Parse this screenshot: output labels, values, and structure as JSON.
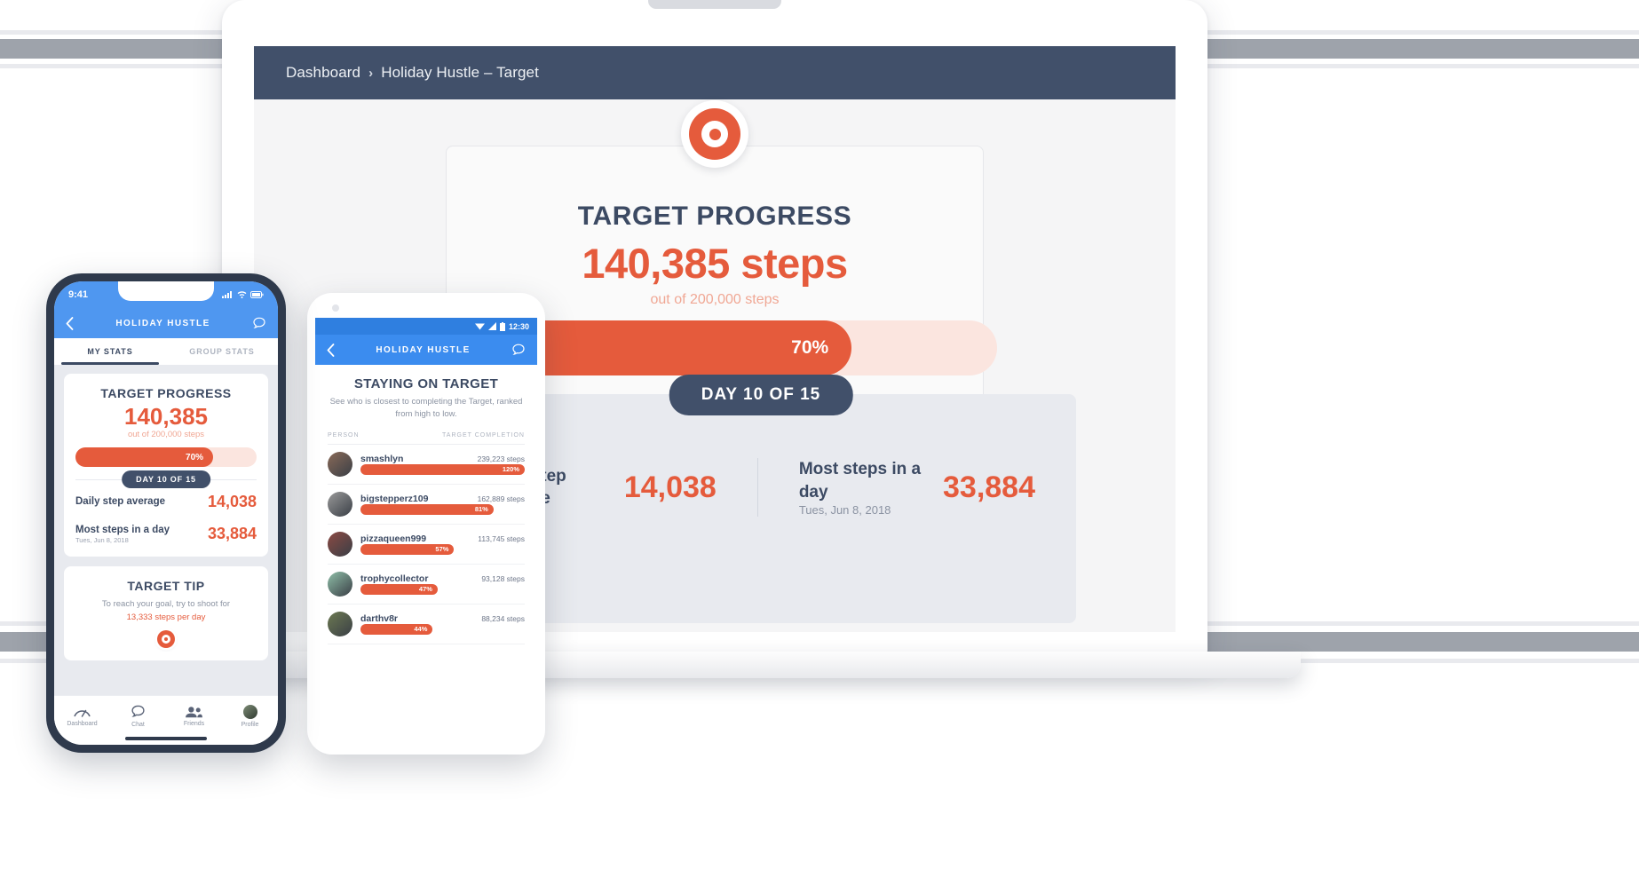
{
  "colors": {
    "accent": "#e55b3c",
    "accent_light": "#fbe5df",
    "accent_soft_text": "#f0a794",
    "dark": "#3c4a63",
    "topbar": "#41506a",
    "ios_blue": "#4f97f0",
    "android_blue": "#3b8cef",
    "page_bg": "#e8eaef"
  },
  "desktop": {
    "breadcrumb": {
      "root": "Dashboard",
      "separator": "›",
      "current": "Holiday Hustle – Target"
    },
    "target_icon": "target-icon",
    "title": "TARGET PROGRESS",
    "steps_value": "140,385 steps",
    "steps_goal": "out of 200,000 steps",
    "progress_label": "70%",
    "progress_percent": 70,
    "day_pill": "DAY 10 OF 15",
    "stats": [
      {
        "label": "Daily step average",
        "date": "",
        "value": "14,038"
      },
      {
        "label": "Most steps in a day",
        "date": "Tues, Jun 8, 2018",
        "value": "33,884"
      }
    ]
  },
  "iphone": {
    "status": {
      "time": "9:41",
      "signal": "signal-icon",
      "wifi": "wifi-icon",
      "battery": "battery-icon"
    },
    "header": {
      "back": "back-chevron-icon",
      "title": "HOLIDAY HUSTLE",
      "chat": "chat-icon"
    },
    "tabs": [
      {
        "label": "MY STATS",
        "active": true
      },
      {
        "label": "GROUP STATS",
        "active": false
      }
    ],
    "progress_card": {
      "title": "TARGET PROGRESS",
      "steps_value": "140,385",
      "steps_goal": "out of 200,000 steps",
      "progress_label": "70%",
      "progress_percent": 70,
      "day_pill": "DAY 10 OF 15",
      "rows": [
        {
          "label": "Daily step average",
          "date": "",
          "value": "14,038"
        },
        {
          "label": "Most steps in a day",
          "date": "Tues, Jun 8, 2018",
          "value": "33,884"
        }
      ]
    },
    "tip_card": {
      "title": "TARGET TIP",
      "text_lead": "To reach your goal, try to shoot for",
      "text_strong": "13,333 steps per day",
      "icon": "target-icon"
    },
    "tabbar": [
      {
        "icon": "activity-icon",
        "label": "Dashboard"
      },
      {
        "icon": "chat-icon",
        "label": "Chat"
      },
      {
        "icon": "friends-icon",
        "label": "Friends"
      },
      {
        "icon": "avatar-icon",
        "label": "Profile"
      }
    ]
  },
  "android": {
    "status": {
      "time": "12:30",
      "wifi": "wifi-icon",
      "signal": "signal-icon",
      "battery": "battery-icon"
    },
    "header": {
      "back": "back-chevron-icon",
      "title": "HOLIDAY HUSTLE",
      "chat": "chat-icon"
    },
    "heading": "STAYING ON TARGET",
    "subheading": "See who is closest to completing the Target, ranked from high to low.",
    "columns": {
      "person": "PERSON",
      "completion": "TARGET COMPLETION"
    },
    "leaderboard": [
      {
        "name": "smashlyn",
        "steps": "239,223 steps",
        "percent_label": "120%",
        "percent": 100,
        "avatar_color": "#8a6a58"
      },
      {
        "name": "bigstepperz109",
        "steps": "162,889 steps",
        "percent_label": "81%",
        "percent": 81,
        "avatar_color": "#9a9a9a"
      },
      {
        "name": "pizzaqueen999",
        "steps": "113,745 steps",
        "percent_label": "57%",
        "percent": 57,
        "avatar_color": "#8c4a43"
      },
      {
        "name": "trophycollector",
        "steps": "93,128 steps",
        "percent_label": "47%",
        "percent": 47,
        "avatar_color": "#8fbfa8"
      },
      {
        "name": "darthv8r",
        "steps": "88,234 steps",
        "percent_label": "44%",
        "percent": 44,
        "avatar_color": "#6d7a52"
      }
    ],
    "tabbar": [
      {
        "icon": "activity-icon"
      },
      {
        "icon": "chat-icon"
      },
      {
        "icon": "friends-icon"
      },
      {
        "icon": "avatar-icon"
      }
    ],
    "navbar": [
      {
        "icon": "back-triangle-icon"
      },
      {
        "icon": "home-circle-icon"
      },
      {
        "icon": "recents-square-icon"
      }
    ]
  }
}
